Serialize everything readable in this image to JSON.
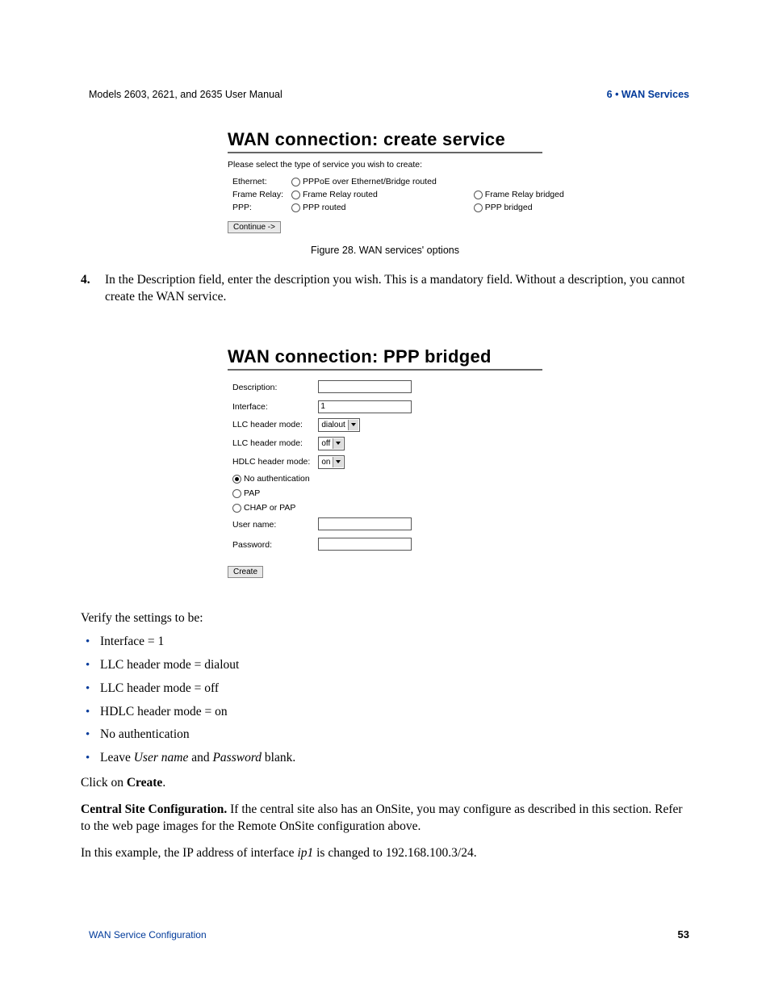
{
  "header": {
    "left": "Models 2603, 2621, and 2635 User Manual",
    "right": "6 • WAN Services"
  },
  "fig28": {
    "title": "WAN connection: create service",
    "instruction": "Please select the type of service you wish to create:",
    "rows": {
      "ethernet_label": "Ethernet:",
      "ethernet_opt1": "PPPoE over Ethernet/Bridge routed",
      "fr_label": "Frame Relay:",
      "fr_opt1": "Frame Relay routed",
      "fr_opt2": "Frame Relay bridged",
      "ppp_label": "PPP:",
      "ppp_opt1": "PPP routed",
      "ppp_opt2": "PPP bridged"
    },
    "continue_btn": "Continue ->",
    "caption": "Figure 28. WAN services' options"
  },
  "step4": {
    "num": "4.",
    "text": "In the Description field, enter the description you wish. This is a mandatory field. Without a description, you cannot create the WAN service."
  },
  "fig29": {
    "title": "WAN connection: PPP bridged",
    "fields": {
      "description_label": "Description:",
      "interface_label": "Interface:",
      "interface_value": "1",
      "llc1_label": "LLC header mode:",
      "llc1_value": "dialout",
      "llc2_label": "LLC header mode:",
      "llc2_value": "off",
      "hdlc_label": "HDLC header mode:",
      "hdlc_value": "on",
      "auth_none": "No authentication",
      "auth_pap": "PAP",
      "auth_chap": "CHAP or PAP",
      "username_label": "User name:",
      "password_label": "Password:"
    },
    "create_btn": "Create"
  },
  "verify": {
    "intro": "Verify the settings to be:",
    "items": [
      "Interface = 1",
      "LLC header mode = dialout",
      "LLC header mode = off",
      "HDLC header mode = on",
      "No authentication"
    ],
    "last_pre": "Leave ",
    "last_i1": "User name",
    "last_mid": " and ",
    "last_i2": "Password",
    "last_post": " blank."
  },
  "click_create_pre": "Click on ",
  "click_create_bold": "Create",
  "click_create_post": ".",
  "central": {
    "bold": "Central Site Configuration. ",
    "rest": "If the central site also has an OnSite, you may configure as described in this section. Refer to the web page images for the Remote OnSite configuration above."
  },
  "example_pre": "In this example, the IP address of interface ",
  "example_i": "ip1",
  "example_post": " is changed to 192.168.100.3/24.",
  "footer": {
    "left": "WAN Service Configuration",
    "right": "53"
  }
}
